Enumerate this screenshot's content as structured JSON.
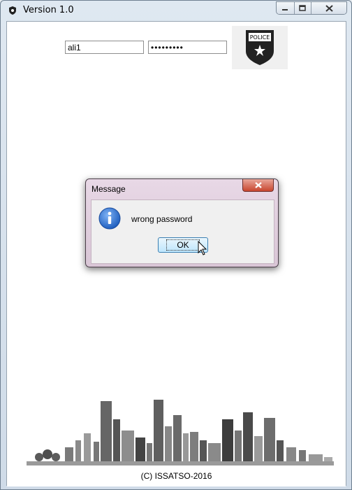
{
  "window": {
    "title": "Version 1.0",
    "icon": "shield-icon",
    "controls": [
      "minimize-icon",
      "maximize-icon",
      "close-icon"
    ]
  },
  "login": {
    "username_value": "ali1",
    "password_value": "•••••••••"
  },
  "badge": {
    "icon": "police-badge-icon",
    "text": "POLICE"
  },
  "footer": {
    "copyright": "(C) ISSATSO-2016"
  },
  "dialog": {
    "title": "Message",
    "icon": "info-icon",
    "message": "wrong password",
    "ok_label": "OK"
  },
  "colors": {
    "titlebar": "#dfe8f1",
    "dialog_frame": "#e8d8e6",
    "close_red": "#c8462f",
    "ok_button": "#bee6fd",
    "info_blue": "#1f5fbf"
  }
}
